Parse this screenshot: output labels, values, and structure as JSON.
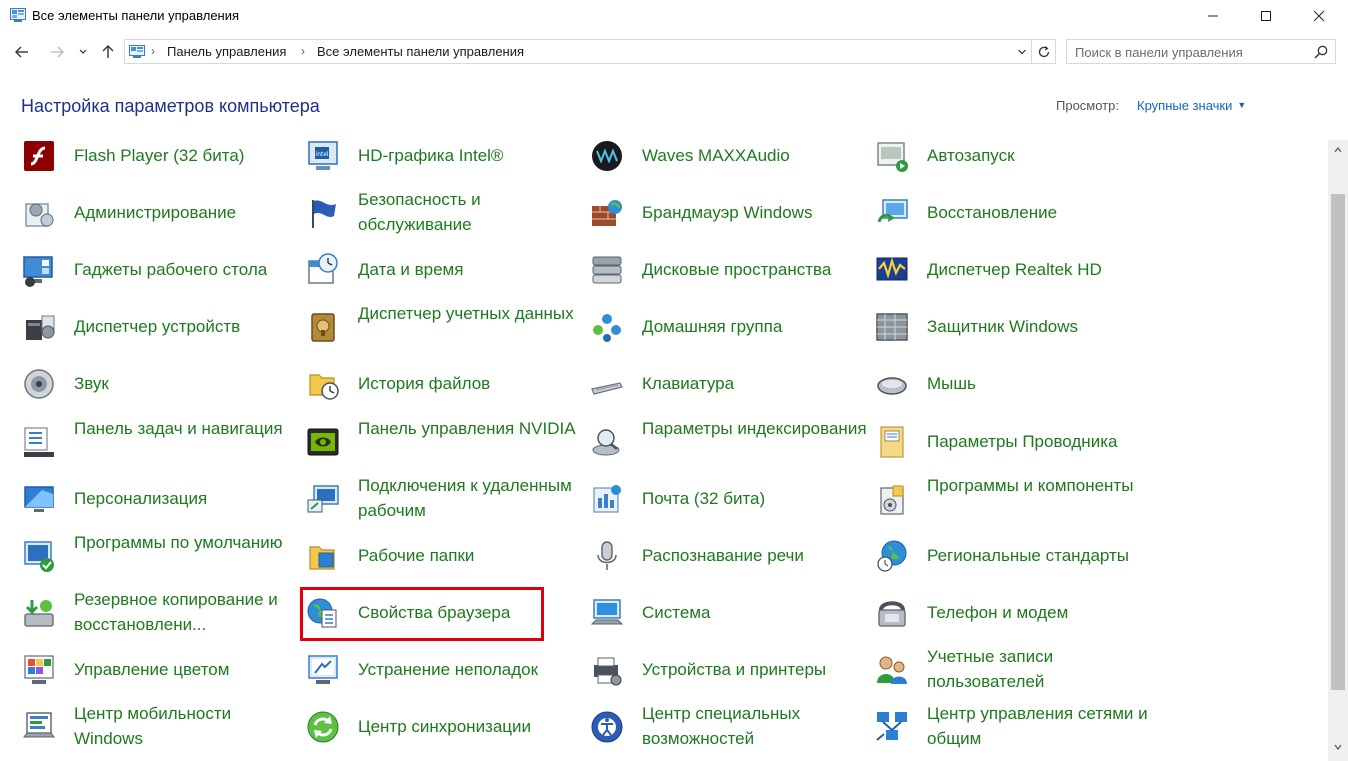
{
  "window": {
    "title": "Все элементы панели управления"
  },
  "address": {
    "crumbs": [
      "Панель управления",
      "Все элементы панели управления"
    ]
  },
  "search": {
    "placeholder": "Поиск в панели управления"
  },
  "page": {
    "heading": "Настройка параметров компьютера",
    "view_label": "Просмотр:",
    "view_value": "Крупные значки"
  },
  "items": [
    {
      "label": "Flash Player (32 бита)",
      "icon": "flash-player-icon"
    },
    {
      "label": "HD-графика Intel®",
      "icon": "intel-graphics-icon"
    },
    {
      "label": "Waves MAXXAudio",
      "icon": "waves-audio-icon"
    },
    {
      "label": "Автозапуск",
      "icon": "autoplay-icon"
    },
    {
      "label": "Администрирование",
      "icon": "admin-tools-icon"
    },
    {
      "label": "Безопасность и обслуживание",
      "icon": "security-flag-icon"
    },
    {
      "label": "Брандмауэр Windows",
      "icon": "firewall-icon"
    },
    {
      "label": "Восстановление",
      "icon": "recovery-icon"
    },
    {
      "label": "Гаджеты рабочего стола",
      "icon": "gadgets-icon"
    },
    {
      "label": "Дата и время",
      "icon": "date-time-icon"
    },
    {
      "label": "Дисковые пространства",
      "icon": "storage-spaces-icon"
    },
    {
      "label": "Диспетчер Realtek HD",
      "icon": "realtek-icon"
    },
    {
      "label": "Диспетчер устройств",
      "icon": "device-manager-icon"
    },
    {
      "label": "Диспетчер учетных данных",
      "icon": "credential-manager-icon"
    },
    {
      "label": "Домашняя группа",
      "icon": "homegroup-icon"
    },
    {
      "label": "Защитник Windows",
      "icon": "defender-icon"
    },
    {
      "label": "Звук",
      "icon": "sound-icon"
    },
    {
      "label": "История файлов",
      "icon": "file-history-icon"
    },
    {
      "label": "Клавиатура",
      "icon": "keyboard-icon"
    },
    {
      "label": "Мышь",
      "icon": "mouse-icon"
    },
    {
      "label": "Панель задач и навигация",
      "icon": "taskbar-icon"
    },
    {
      "label": "Панель управления NVIDIA",
      "icon": "nvidia-icon"
    },
    {
      "label": "Параметры индексирования",
      "icon": "indexing-icon"
    },
    {
      "label": "Параметры Проводника",
      "icon": "explorer-options-icon"
    },
    {
      "label": "Персонализация",
      "icon": "personalization-icon"
    },
    {
      "label": "Подключения к удаленным рабочим",
      "icon": "remote-desktop-icon"
    },
    {
      "label": "Почта (32 бита)",
      "icon": "mail-icon"
    },
    {
      "label": "Программы и компоненты",
      "icon": "programs-features-icon"
    },
    {
      "label": "Программы по умолчанию",
      "icon": "default-programs-icon"
    },
    {
      "label": "Рабочие папки",
      "icon": "work-folders-icon"
    },
    {
      "label": "Распознавание речи",
      "icon": "microphone-icon"
    },
    {
      "label": "Региональные стандарты",
      "icon": "region-globe-icon"
    },
    {
      "label": "Резервное копирование и восстановлени...",
      "icon": "backup-icon"
    },
    {
      "label": "Свойства браузера",
      "icon": "internet-options-icon"
    },
    {
      "label": "Система",
      "icon": "system-icon"
    },
    {
      "label": "Телефон и модем",
      "icon": "phone-modem-icon"
    },
    {
      "label": "Управление цветом",
      "icon": "color-management-icon"
    },
    {
      "label": "Устранение неполадок",
      "icon": "troubleshooting-icon"
    },
    {
      "label": "Устройства и принтеры",
      "icon": "devices-printers-icon"
    },
    {
      "label": "Учетные записи пользователей",
      "icon": "user-accounts-icon"
    },
    {
      "label": "Центр мобильности Windows",
      "icon": "mobility-center-icon"
    },
    {
      "label": "Центр синхронизации",
      "icon": "sync-center-icon"
    },
    {
      "label": "Центр специальных возможностей",
      "icon": "ease-of-access-icon"
    },
    {
      "label": "Центр управления сетями и общим",
      "icon": "network-center-icon"
    }
  ],
  "colors": {
    "item_text": "#1d7a1d",
    "heading": "#1e3287",
    "link": "#1565c0",
    "highlight": "#e0000d"
  }
}
